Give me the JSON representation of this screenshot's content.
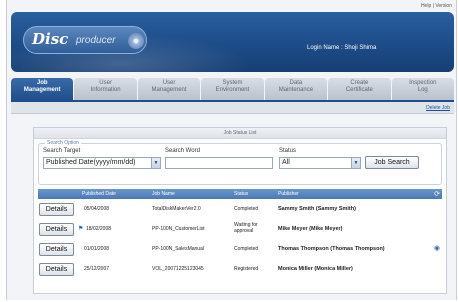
{
  "top_links": {
    "help": "Help",
    "separator": " | ",
    "version": "Version"
  },
  "header": {
    "logo_disc": "Disc",
    "logo_producer": "producer",
    "login_label": "Login Name : Shoji Shima"
  },
  "tabs": [
    {
      "line1": "Job",
      "line2": "Management"
    },
    {
      "line1": "User",
      "line2": "Information"
    },
    {
      "line1": "User",
      "line2": "Management"
    },
    {
      "line1": "System",
      "line2": "Environment"
    },
    {
      "line1": "Data",
      "line2": "Maintenance"
    },
    {
      "line1": "Create",
      "line2": "Certificate"
    },
    {
      "line1": "Inspection",
      "line2": "Log"
    }
  ],
  "subbar": {
    "delete_job": "Delete Job"
  },
  "panel": {
    "title": "Job Status List"
  },
  "search": {
    "legend": "Search Option",
    "target_label": "Search Target",
    "target_value": "Published Date(yyyy/mm/dd)",
    "word_label": "Search Word",
    "word_value": "",
    "status_label": "Status",
    "status_value": "All",
    "search_button": "Job Search"
  },
  "table": {
    "headers": {
      "date": "Published Date",
      "job": "Job Name",
      "status": "Status",
      "publisher": "Publisher"
    },
    "details_label": "Details",
    "rows": [
      {
        "date": "05/04/2008",
        "job": "TotalDiskMakerVer2.0",
        "status_1": "Completed",
        "status_2": "",
        "publisher": "Sammy Smith (Sammy Smith)"
      },
      {
        "date": "18/02/2008",
        "job": "PP-100N_CustomerList",
        "status_1": "Waiting for",
        "status_2": "approval",
        "publisher": "Mike Meyer (Mike Meyer)"
      },
      {
        "date": "01/01/2008",
        "job": "PP-100N_SalesManual",
        "status_1": "Completed",
        "status_2": "",
        "publisher": "Thomas Thompson (Thomas Thompson)"
      },
      {
        "date": "25/12/2007",
        "job": "VOL_20071225123045",
        "status_1": "Registered",
        "status_2": "",
        "publisher": "Monica Miller (Monica Miller)"
      }
    ]
  },
  "icons": {
    "dropdown": "chevron-down-icon",
    "flag": "flag-icon",
    "refresh": "refresh-icon",
    "disc": "disc-icon"
  },
  "colors": {
    "accent": "#1f4e8a",
    "header_row": "#4a78b5",
    "link": "#1f4ea0"
  }
}
